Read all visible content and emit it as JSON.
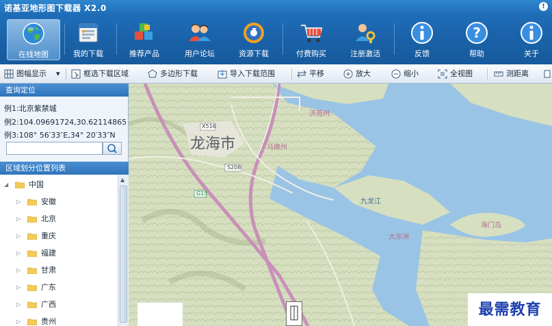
{
  "app": {
    "title": "诺基亚地形图下载器 X2.0"
  },
  "ribbon": [
    {
      "label": "在线地图",
      "icon": "globe-icon",
      "active": true
    },
    {
      "label": "我的下载",
      "icon": "download-list-icon"
    },
    {
      "label": "推荐产品",
      "icon": "cubes-icon"
    },
    {
      "label": "用户论坛",
      "icon": "users-icon"
    },
    {
      "label": "资源下载",
      "icon": "resource-disc-icon"
    },
    {
      "label": "付费购买",
      "icon": "cart-icon"
    },
    {
      "label": "注册激活",
      "icon": "user-key-icon"
    },
    {
      "label": "反馈",
      "icon": "info-icon"
    },
    {
      "label": "帮助",
      "icon": "help-icon"
    },
    {
      "label": "关于",
      "icon": "info-icon"
    }
  ],
  "toolbar": {
    "frame_display": "图幅显示",
    "box_select": "框选下载区域",
    "polygon": "多边形下载",
    "import_range": "导入下载范围",
    "pan": "平移",
    "zoom_in": "放大",
    "zoom_out": "缩小",
    "full_view": "全视图",
    "measure": "测距离"
  },
  "query": {
    "header": "查询定位",
    "example1": "例1:北京紫禁城",
    "example2": "例2:104.09691724,30.62114865",
    "example3": "例3:108° 56′33″E,34° 20′33″N",
    "search_value": ""
  },
  "region": {
    "header": "区域划分位置列表",
    "root": "中国",
    "provinces": [
      "安徽",
      "北京",
      "重庆",
      "福建",
      "甘肃",
      "广东",
      "广西",
      "贵州"
    ]
  },
  "map": {
    "labels": {
      "city": "龙海市",
      "jixing": "济蔸州",
      "wumiao": "乌礁州",
      "jiulong": "九龙江",
      "datu": "大涂洲",
      "haimen": "海门岛",
      "road_x516": "X516",
      "road_s208": "S208",
      "road_g15": "G15"
    },
    "colors": {
      "water": "#9ac4e6",
      "land": "#d6dfc0",
      "road": "#c890b8"
    }
  },
  "watermark": "最需教育"
}
